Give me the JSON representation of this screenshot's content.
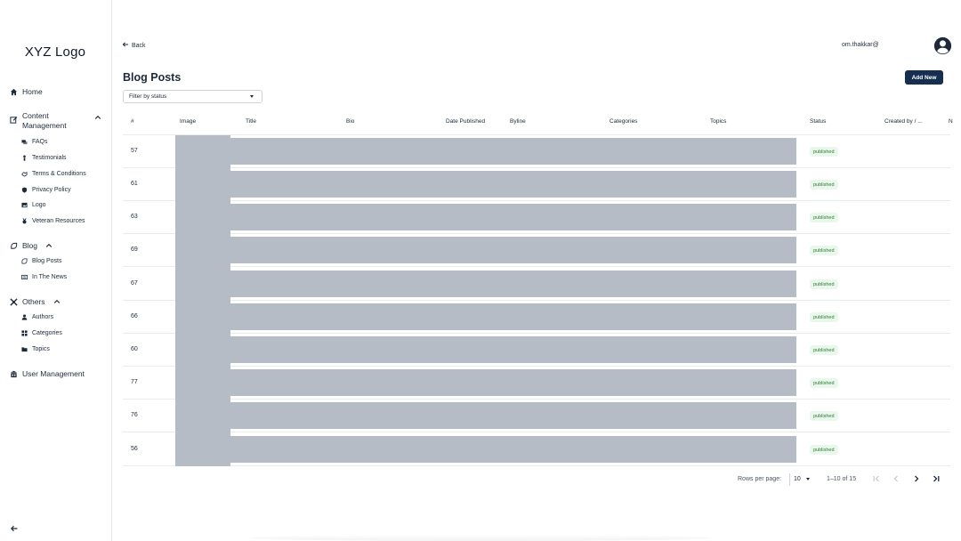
{
  "sidebar": {
    "logo": "XYZ Logo",
    "home": "Home",
    "content_management": "Content Management",
    "content_items": [
      "FAQs",
      "Testimonials",
      "Terms & Conditions",
      "Privacy Policy",
      "Logo",
      "Veteran Resources"
    ],
    "blog": "Blog",
    "blog_items": [
      "Blog Posts",
      "In The News"
    ],
    "others": "Others",
    "others_items": [
      "Authors",
      "Categories",
      "Topics"
    ],
    "user_management": "User Management"
  },
  "header": {
    "back": "Back",
    "user_email": "om.thakkar@",
    "title": "Blog Posts",
    "add_new": "Add New",
    "filter_placeholder": "Filter by status"
  },
  "table": {
    "columns": [
      "#",
      "Image",
      "Title",
      "Bio",
      "Date Published",
      "Byline",
      "Categories",
      "Topics",
      "Status",
      "Created by / ..."
    ],
    "rows": [
      {
        "id": "57",
        "status": "published"
      },
      {
        "id": "61",
        "status": "published"
      },
      {
        "id": "63",
        "status": "published"
      },
      {
        "id": "69",
        "status": "published"
      },
      {
        "id": "67",
        "status": "published"
      },
      {
        "id": "66",
        "status": "published"
      },
      {
        "id": "60",
        "status": "published"
      },
      {
        "id": "77",
        "status": "published"
      },
      {
        "id": "76",
        "status": "published"
      },
      {
        "id": "56",
        "status": "published"
      }
    ]
  },
  "pagination": {
    "rows_per_page_label": "Rows per page:",
    "rows_per_page": "10",
    "range": "1–10 of 15"
  },
  "colors": {
    "primary": "#162e4f",
    "status_bg": "#eaf7ec",
    "status_text": "#2e7d32",
    "redaction": "#b6bcc6"
  }
}
